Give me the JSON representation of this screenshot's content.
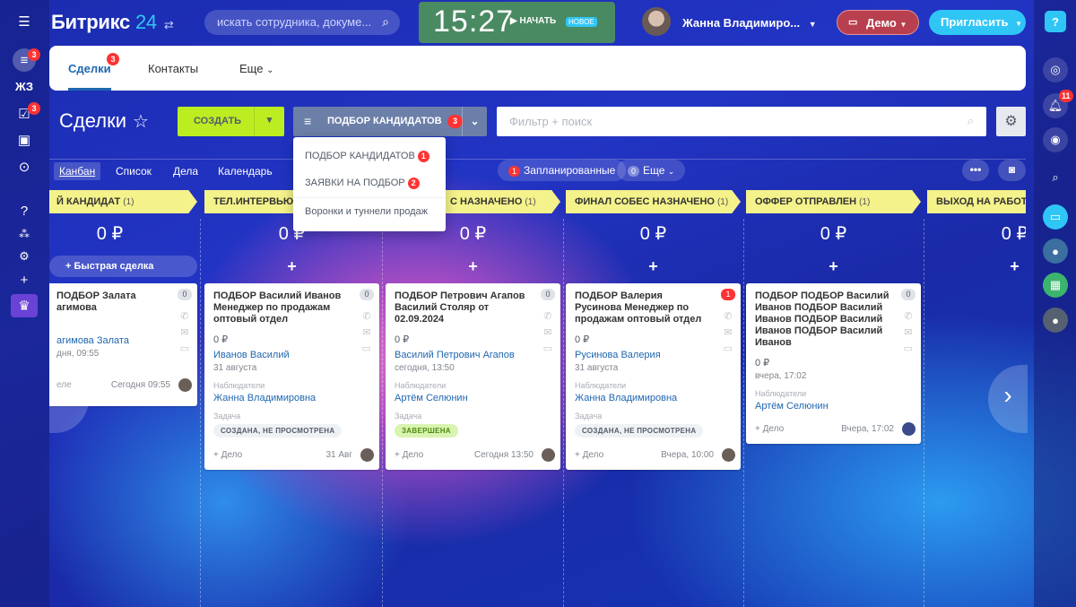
{
  "header": {
    "logo_main": "Битрикс",
    "logo_num": "24",
    "search_placeholder": "искать сотрудника, докуме...",
    "clock": "15:27",
    "start": "НАЧАТЬ",
    "new_badge": "НОВОЕ",
    "user_name": "Жанна Владимиро...",
    "demo": "Демо",
    "invite": "Пригласить"
  },
  "left_sidebar": {
    "badge1": "3",
    "jz": "ЖЗ",
    "badge2": "3"
  },
  "right_sidebar": {
    "notif_badge": "11"
  },
  "top_tabs": [
    {
      "label": "Сделки",
      "badge": "3"
    },
    {
      "label": "Контакты"
    },
    {
      "label": "Еще"
    }
  ],
  "toolbar": {
    "title": "Сделки",
    "create": "СОЗДАТЬ",
    "funnel": "ПОДБОР КАНДИДАТОВ",
    "funnel_count": "3",
    "filter_placeholder": "Фильтр + поиск"
  },
  "views": {
    "tabs": [
      "Канбан",
      "Список",
      "Дела",
      "Календарь"
    ],
    "planned": "Запланированные",
    "planned_badge": "1",
    "more": "Еще",
    "zero": "0"
  },
  "dropdown": {
    "items": [
      {
        "label": "ПОДБОР КАНДИДАТОВ",
        "badge": "1"
      },
      {
        "label": "ЗАЯВКИ НА ПОДБОР",
        "badge": "2"
      },
      {
        "label": "Воронки и туннели продаж"
      }
    ]
  },
  "quick_deal": "+ Быстрая сделка",
  "stages": [
    {
      "name": "Й КАНДИДАТ",
      "count": "(1)",
      "sum": "0 ₽",
      "card": {
        "title": "ПОДБОР Залата\nагимова",
        "price": "",
        "contact": "агимова Залата",
        "date": "дня, 09:55",
        "footer_left": "еле",
        "footer_time": "Сегодня 09:55",
        "counter": "0"
      }
    },
    {
      "name": "ТЕЛ.ИНТЕРВЬЮ ПЕ",
      "count": "",
      "sum": "0 ₽",
      "card": {
        "title": "ПОДБОР Василий Иванов Менеджер по продажам оптовый отдел",
        "price": "0 ₽",
        "contact": "Иванов Василий",
        "date": "31 августа",
        "watchers_label": "Наблюдатели",
        "watcher": "Жанна Владимировна",
        "task_label": "Задача",
        "task_status": "СОЗДАНА, НЕ ПРОСМОТРЕНА",
        "add_activity": "+ Дело",
        "footer_time": "31 Авг",
        "counter": "0"
      }
    },
    {
      "name": "С НАЗНАЧЕНО",
      "count": "(1)",
      "sum": "0 ₽",
      "card": {
        "title": "ПОДБОР Петрович Агапов Василий Столяр от 02.09.2024",
        "price": "0 ₽",
        "contact": "Василий Петрович Агапов",
        "date": "сегодня, 13:50",
        "watchers_label": "Наблюдатели",
        "watcher": "Артём Селюнин",
        "task_label": "Задача",
        "task_status": "ЗАВЕРШЕНА",
        "add_activity": "+ Дело",
        "footer_time": "Сегодня 13:50",
        "counter": "0"
      }
    },
    {
      "name": "ФИНАЛ СОБЕС НАЗНАЧЕНО",
      "count": "(1)",
      "sum": "0 ₽",
      "card": {
        "title": "ПОДБОР Валерия Русинова Менеджер по продажам оптовый отдел",
        "price": "0 ₽",
        "contact": "Русинова Валерия",
        "date": "31 августа",
        "watchers_label": "Наблюдатели",
        "watcher": "Жанна Владимировна",
        "task_label": "Задача",
        "task_status": "СОЗДАНА, НЕ ПРОСМОТРЕНА",
        "add_activity": "+ Дело",
        "footer_time": "Вчера, 10:00",
        "counter": "1"
      }
    },
    {
      "name": "ОФФЕР ОТПРАВЛЕН",
      "count": "(1)",
      "sum": "0 ₽",
      "card": {
        "title": "ПОДБОР ПОДБОР Василий Иванов ПОДБОР Василий Иванов ПОДБОР Василий Иванов ПОДБОР Василий Иванов",
        "price": "0 ₽",
        "date": "вчера, 17:02",
        "watchers_label": "Наблюдатели",
        "watcher": "Артём Селюнин",
        "add_activity": "+ Дело",
        "footer_time": "Вчера, 17:02",
        "counter": "0"
      }
    },
    {
      "name": "ВЫХОД НА РАБОТУ",
      "count": "",
      "sum": "0 ₽"
    }
  ],
  "colors": {
    "accent": "#2fc6f6",
    "create": "#bbed21",
    "stage": "#f4f28a",
    "danger": "#ff3333"
  }
}
